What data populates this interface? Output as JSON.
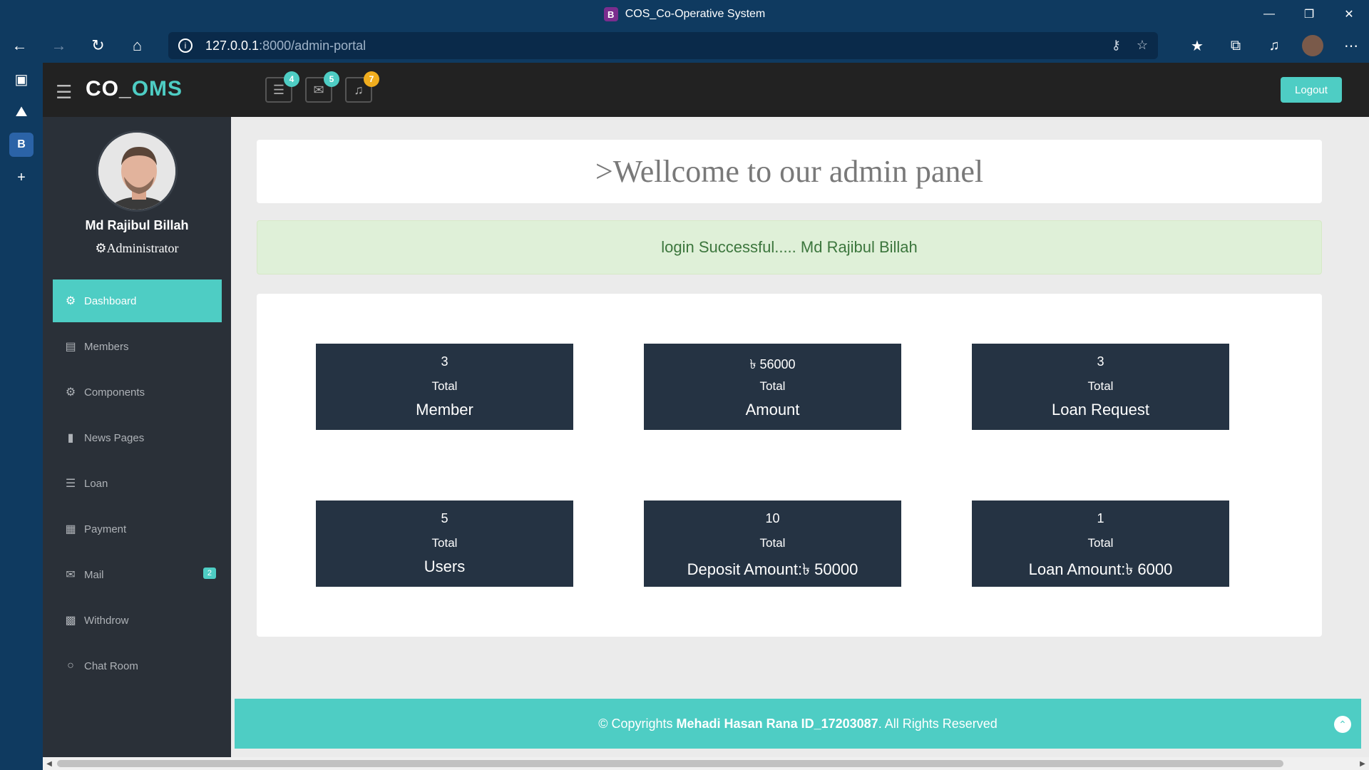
{
  "browser": {
    "tab_title": "COS_Co-Operative System",
    "tab_icon": "B",
    "url_host": "127.0.0.1",
    "url_path": ":8000/admin-portal"
  },
  "app": {
    "logo_prefix": "CO_",
    "logo_suffix": "OMS",
    "logout_label": "Logout",
    "badges": {
      "tasks": "4",
      "messages": "5",
      "notifications": "7"
    },
    "colors": {
      "accent": "#4ecdc4",
      "sidebar": "#2a3038",
      "topbar": "#222222",
      "stat_card": "#253343",
      "notification_badge": "#f0ad1e"
    }
  },
  "profile": {
    "name": "Md Rajibul Billah",
    "role": "Administrator"
  },
  "sidebar": {
    "items": [
      {
        "label": "Dashboard",
        "icon": "dashboard-icon"
      },
      {
        "label": "Members",
        "icon": "desktop-icon"
      },
      {
        "label": "Components",
        "icon": "cogs-icon"
      },
      {
        "label": "News Pages",
        "icon": "book-icon"
      },
      {
        "label": "Loan",
        "icon": "tasks-icon"
      },
      {
        "label": "Payment",
        "icon": "grid-icon"
      },
      {
        "label": "Mail",
        "icon": "envelope-icon",
        "badge": "2"
      },
      {
        "label": "Withdrow",
        "icon": "bar-chart-icon"
      },
      {
        "label": "Chat Room",
        "icon": "comments-icon"
      }
    ]
  },
  "main": {
    "welcome": ">Wellcome to our admin panel",
    "alert": "login Successful..... Md Rajibul Billah",
    "stats": [
      {
        "value": "3",
        "total": "Total",
        "label": "Member"
      },
      {
        "value": "৳ 56000",
        "total": "Total",
        "label": "Amount"
      },
      {
        "value": "3",
        "total": "Total",
        "label": "Loan Request"
      },
      {
        "value": "5",
        "total": "Total",
        "label": "Users"
      },
      {
        "value": "10",
        "total": "Total",
        "label": "Deposit Amount:৳ 50000"
      },
      {
        "value": "1",
        "total": "Total",
        "label": "Loan Amount:৳ 6000"
      }
    ]
  },
  "footer": {
    "prefix": "© Copyrights ",
    "author": "Mehadi Hasan Rana ID_17203087",
    "suffix": ". All Rights Reserved"
  }
}
